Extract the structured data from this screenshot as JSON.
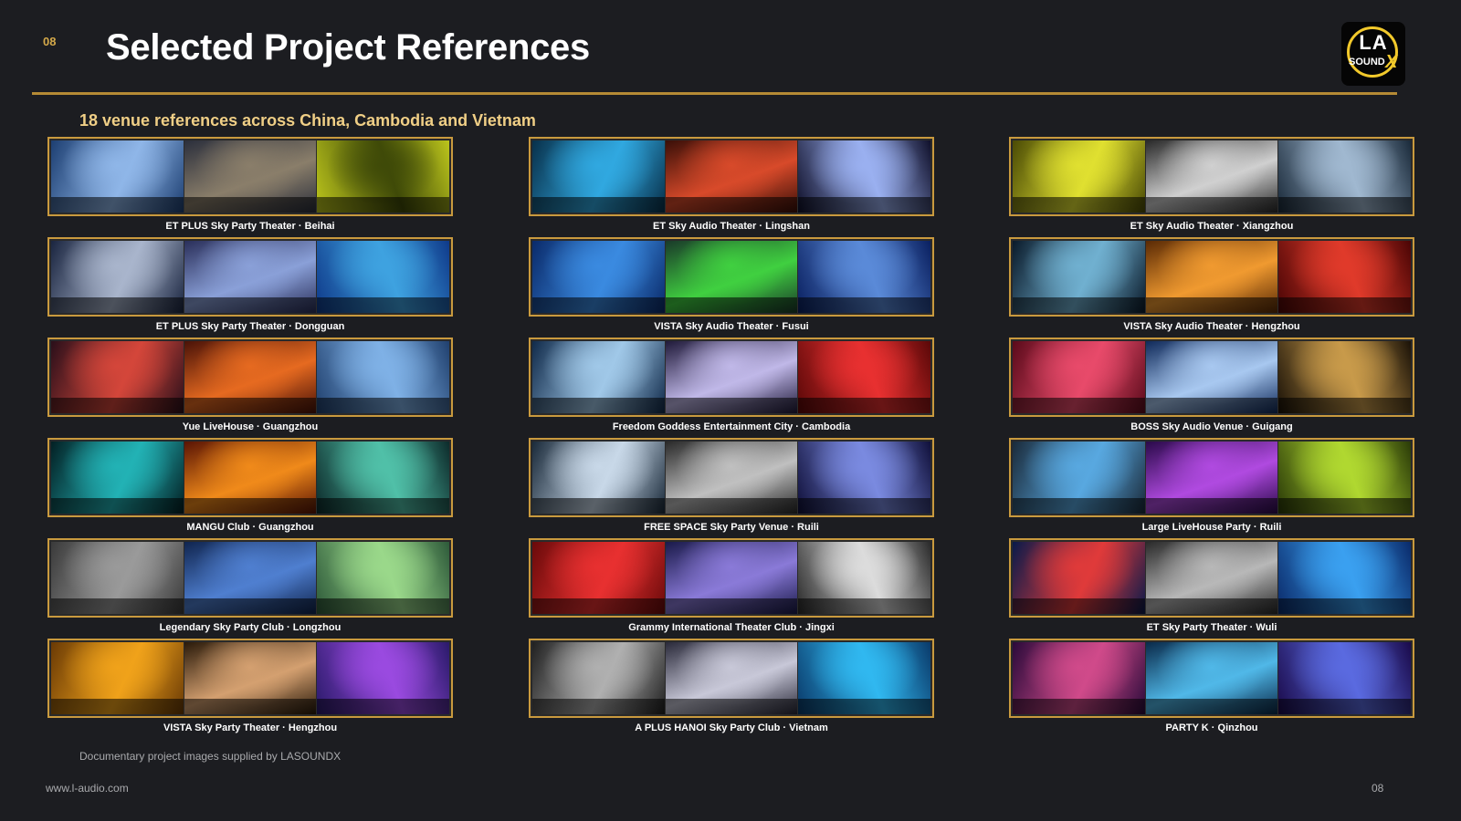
{
  "header": {
    "page_number": "08",
    "title": "Selected Project References"
  },
  "logo": {
    "line1": "LA",
    "line2": "SOUND",
    "mark": "X"
  },
  "subtitle": "18 venue references across China, Cambodia and Vietnam",
  "projects": [
    {
      "caption": "ET PLUS Sky Party Theater · Beihai",
      "photos": [
        [
          "#1d3f72",
          "#8fb6e8"
        ],
        [
          "#2b2f3c",
          "#8a7e6a"
        ],
        [
          "#bcc51c",
          "#3f4a08"
        ]
      ]
    },
    {
      "caption": "ET PLUS Sky Party Theater · Dongguan",
      "photos": [
        [
          "#1a2540",
          "#a9b5cc"
        ],
        [
          "#2a2f5a",
          "#8aa0d8"
        ],
        [
          "#0f3a8a",
          "#3ea2e0"
        ]
      ]
    },
    {
      "caption": "Yue LiveHouse · Guangzhou",
      "photos": [
        [
          "#2a0f1a",
          "#d4463a"
        ],
        [
          "#4a1208",
          "#e66a20"
        ],
        [
          "#20406e",
          "#7fb1e6"
        ]
      ]
    },
    {
      "caption": "MANGU Club · Guangzhou",
      "photos": [
        [
          "#032024",
          "#22b2b5"
        ],
        [
          "#5a1404",
          "#f08a1a"
        ],
        [
          "#0d2b2b",
          "#50c0a8"
        ]
      ]
    },
    {
      "caption": "Legendary Sky Party Club · Longzhou",
      "photos": [
        [
          "#3a3a3a",
          "#9a9a9a"
        ],
        [
          "#10254f",
          "#4f7fd0"
        ],
        [
          "#2e5a3a",
          "#9ad88a"
        ]
      ]
    },
    {
      "caption": "VISTA Sky Party Theater · Hengzhou",
      "photos": [
        [
          "#6a3a05",
          "#f0a21a"
        ],
        [
          "#2a1a0a",
          "#d4a070"
        ],
        [
          "#2a1a6a",
          "#9a4ae0"
        ]
      ]
    },
    {
      "caption": "ET Sky Audio Theater · Lingshan",
      "photos": [
        [
          "#08304a",
          "#30a8e0"
        ],
        [
          "#3a0f08",
          "#d84a2a"
        ],
        [
          "#10102a",
          "#9ab0f0"
        ]
      ]
    },
    {
      "caption": "VISTA Sky Audio Theater · Fusui",
      "photos": [
        [
          "#0a2a6a",
          "#3a8ae0"
        ],
        [
          "#1a3a2a",
          "#40d040"
        ],
        [
          "#0a2060",
          "#5a8ad8"
        ]
      ]
    },
    {
      "caption": "Freedom Goddess Entertainment City · Cambodia",
      "photos": [
        [
          "#102a4a",
          "#a0c8e8"
        ],
        [
          "#201a3a",
          "#c0b8e8"
        ],
        [
          "#5a0808",
          "#e83030"
        ]
      ]
    },
    {
      "caption": "FREE SPACE Sky Party Venue · Ruili",
      "photos": [
        [
          "#1a2a3a",
          "#c8d8e8"
        ],
        [
          "#2a2a2a",
          "#c0c0c0"
        ],
        [
          "#10103a",
          "#7a8ae0"
        ]
      ]
    },
    {
      "caption": "Grammy International Theater Club · Jingxi",
      "photos": [
        [
          "#6a0a0a",
          "#e83030"
        ],
        [
          "#1a1a4a",
          "#8a7ad8"
        ],
        [
          "#2a2a2a",
          "#dcdcdc"
        ]
      ]
    },
    {
      "caption": "A PLUS HANOI Sky Party Club · Vietnam",
      "photos": [
        [
          "#202020",
          "#b0b0b0"
        ],
        [
          "#2a2a3a",
          "#c8c8d8"
        ],
        [
          "#0a3a6a",
          "#30b8f0"
        ]
      ]
    },
    {
      "caption": "ET Sky Audio Theater · Xiangzhou",
      "photos": [
        [
          "#4a4a05",
          "#e0e030"
        ],
        [
          "#2a2a2a",
          "#d0d0d0"
        ],
        [
          "#1a2a3a",
          "#a0b8d0"
        ]
      ]
    },
    {
      "caption": "VISTA Sky Audio Theater · Hengzhou",
      "photos": [
        [
          "#0a1a2a",
          "#70b0d0"
        ],
        [
          "#5a2a05",
          "#f09a30"
        ],
        [
          "#4a0505",
          "#e03a2a"
        ]
      ]
    },
    {
      "caption": "BOSS Sky Audio Venue · Guigang",
      "photos": [
        [
          "#5a0a1a",
          "#e84a6a"
        ],
        [
          "#102a5a",
          "#a8c8f0"
        ],
        [
          "#1a1208",
          "#c89a4a"
        ]
      ]
    },
    {
      "caption": "Large LiveHouse Party · Ruili",
      "photos": [
        [
          "#1a2a3a",
          "#58a8e0"
        ],
        [
          "#2a0a4a",
          "#b04ae0"
        ],
        [
          "#2a3a08",
          "#b0d830"
        ]
      ]
    },
    {
      "caption": "ET Sky Party Theater · Wuli",
      "photos": [
        [
          "#0a1a4a",
          "#e03a3a"
        ],
        [
          "#2a2a2a",
          "#b8b8b8"
        ],
        [
          "#0a2a6a",
          "#3aa0f0"
        ]
      ]
    },
    {
      "caption": "PARTY K · Qinzhou",
      "photos": [
        [
          "#2a0a3a",
          "#d04a8a"
        ],
        [
          "#0a2a4a",
          "#50b8e8"
        ],
        [
          "#1a0a4a",
          "#5a6ae0"
        ]
      ]
    }
  ],
  "note": "Documentary project images supplied by LASOUNDX",
  "footer": {
    "url": "www.l-audio.com",
    "page_number": "08"
  }
}
